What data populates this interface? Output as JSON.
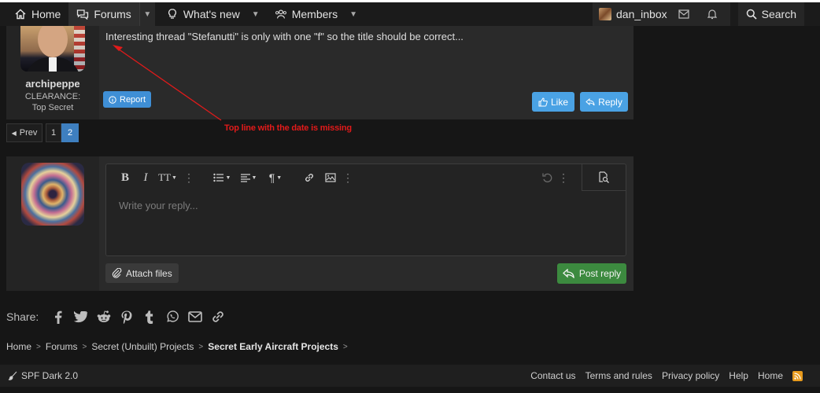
{
  "nav": {
    "home": "Home",
    "forums": "Forums",
    "whats_new": "What's new",
    "members": "Members",
    "username": "dan_inbox",
    "search": "Search"
  },
  "post": {
    "username": "archipeppe",
    "user_title": "CLEARANCE: Top Secret",
    "text": "Interesting thread \"Stefanutti\" is only with one \"f\" so the title should be correct...",
    "report": "Report",
    "like": "Like",
    "reply": "Reply"
  },
  "annotation": {
    "text": "Top line with the date is missing",
    "color": "#e21a1a"
  },
  "pagination": {
    "prev": "Prev",
    "pages": [
      "1",
      "2"
    ],
    "current": "2"
  },
  "editor": {
    "placeholder": "Write your reply...",
    "attach": "Attach files",
    "post_reply": "Post reply"
  },
  "share": {
    "label": "Share:",
    "icons": [
      "facebook-icon",
      "twitter-icon",
      "reddit-icon",
      "pinterest-icon",
      "tumblr-icon",
      "whatsapp-icon",
      "email-icon",
      "link-icon"
    ]
  },
  "breadcrumb": [
    "Home",
    "Forums",
    "Secret (Unbuilt) Projects",
    "Secret Early Aircraft Projects"
  ],
  "footer": {
    "style": "SPF Dark 2.0",
    "links": [
      "Contact us",
      "Terms and rules",
      "Privacy policy",
      "Help",
      "Home"
    ]
  },
  "colors": {
    "accent": "#4aa2e4",
    "post_reply": "#3c8a3f",
    "background": "#161616"
  }
}
